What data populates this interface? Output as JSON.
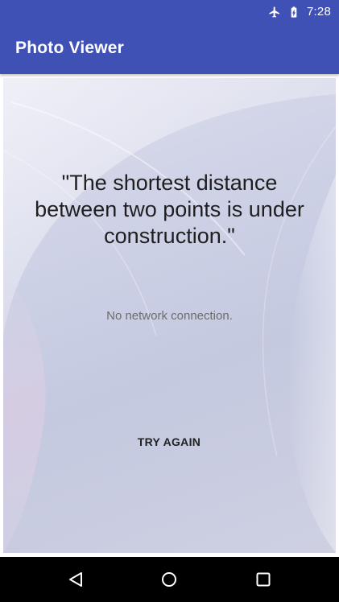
{
  "status_bar": {
    "time": "7:28",
    "icons": [
      "airplane-mode-icon",
      "battery-icon"
    ]
  },
  "app_bar": {
    "title": "Photo Viewer"
  },
  "content": {
    "quote": "\"The shortest distance between two points is under construction.\"",
    "message": "No network connection.",
    "retry_label": "TRY AGAIN"
  },
  "nav_bar": {
    "icons": [
      "back-icon",
      "home-icon",
      "recents-icon"
    ]
  },
  "colors": {
    "primary": "#3f51b5",
    "nav_background": "#000000"
  }
}
